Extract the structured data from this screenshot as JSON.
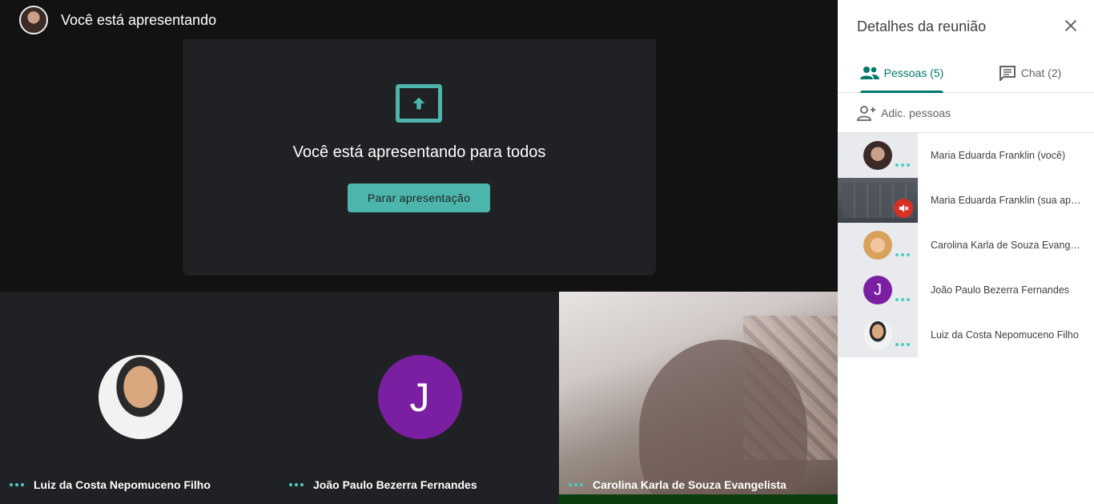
{
  "topbar": {
    "title": "Você está apresentando"
  },
  "presentation": {
    "message": "Você está apresentando para todos",
    "stop_label": "Parar apresentação"
  },
  "tiles": [
    {
      "name": "Luiz da Costa Nepomuceno Filho"
    },
    {
      "name": "João Paulo Bezerra Fernandes",
      "initial": "J"
    },
    {
      "name": "Carolina Karla de Souza Evangelista"
    }
  ],
  "panel": {
    "title": "Detalhes da reunião",
    "tabs": [
      {
        "label": "Pessoas (5)",
        "icon": "people-icon"
      },
      {
        "label": "Chat (2)",
        "icon": "chat-icon"
      }
    ],
    "add_people": "Adic. pessoas",
    "people": [
      {
        "name": "Maria Eduarda Franklin (você)"
      },
      {
        "name": "Maria Eduarda Franklin (sua apresentação)"
      },
      {
        "name": "Carolina Karla de Souza Evangelista"
      },
      {
        "name": "João Paulo Bezerra Fernandes",
        "initial": "J"
      },
      {
        "name": "Luiz da Costa Nepomuceno Filho"
      }
    ]
  },
  "colors": {
    "accent": "#4db6ac",
    "panel_accent": "#00796b",
    "purple": "#7b1fa2",
    "muted_red": "#d93025"
  }
}
